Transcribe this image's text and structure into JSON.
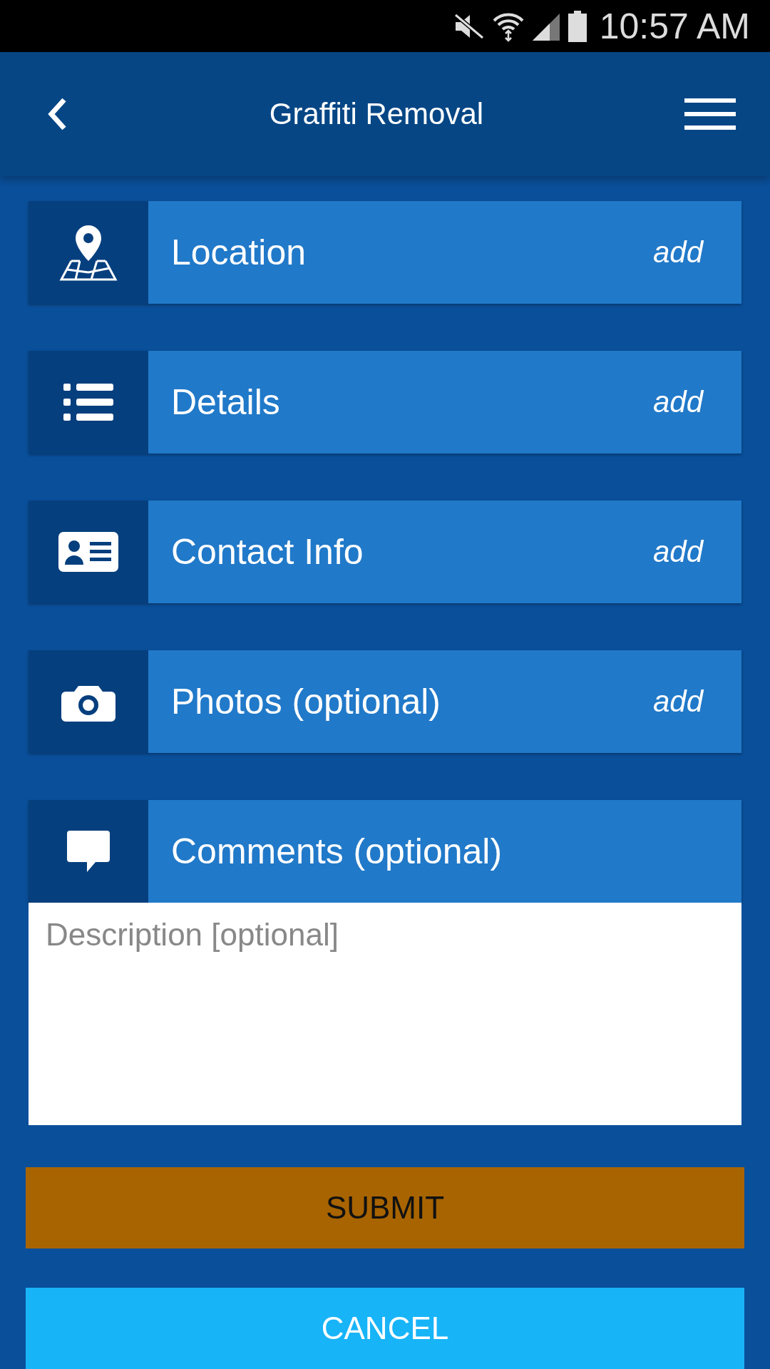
{
  "status_bar": {
    "time": "10:57 AM"
  },
  "header": {
    "title": "Graffiti Removal"
  },
  "sections": [
    {
      "kind": "row",
      "label": "Location",
      "action": "add"
    },
    {
      "kind": "row",
      "label": "Details",
      "action": "add"
    },
    {
      "kind": "row",
      "label": "Contact Info",
      "action": "add"
    },
    {
      "kind": "row",
      "label": "Photos (optional)",
      "action": "add"
    },
    {
      "kind": "comments",
      "label": "Comments (optional)",
      "placeholder": "Description [optional]"
    }
  ],
  "buttons": [
    {
      "kind": "submit",
      "label": "SUBMIT"
    },
    {
      "kind": "cancel",
      "label": "CANCEL"
    }
  ]
}
